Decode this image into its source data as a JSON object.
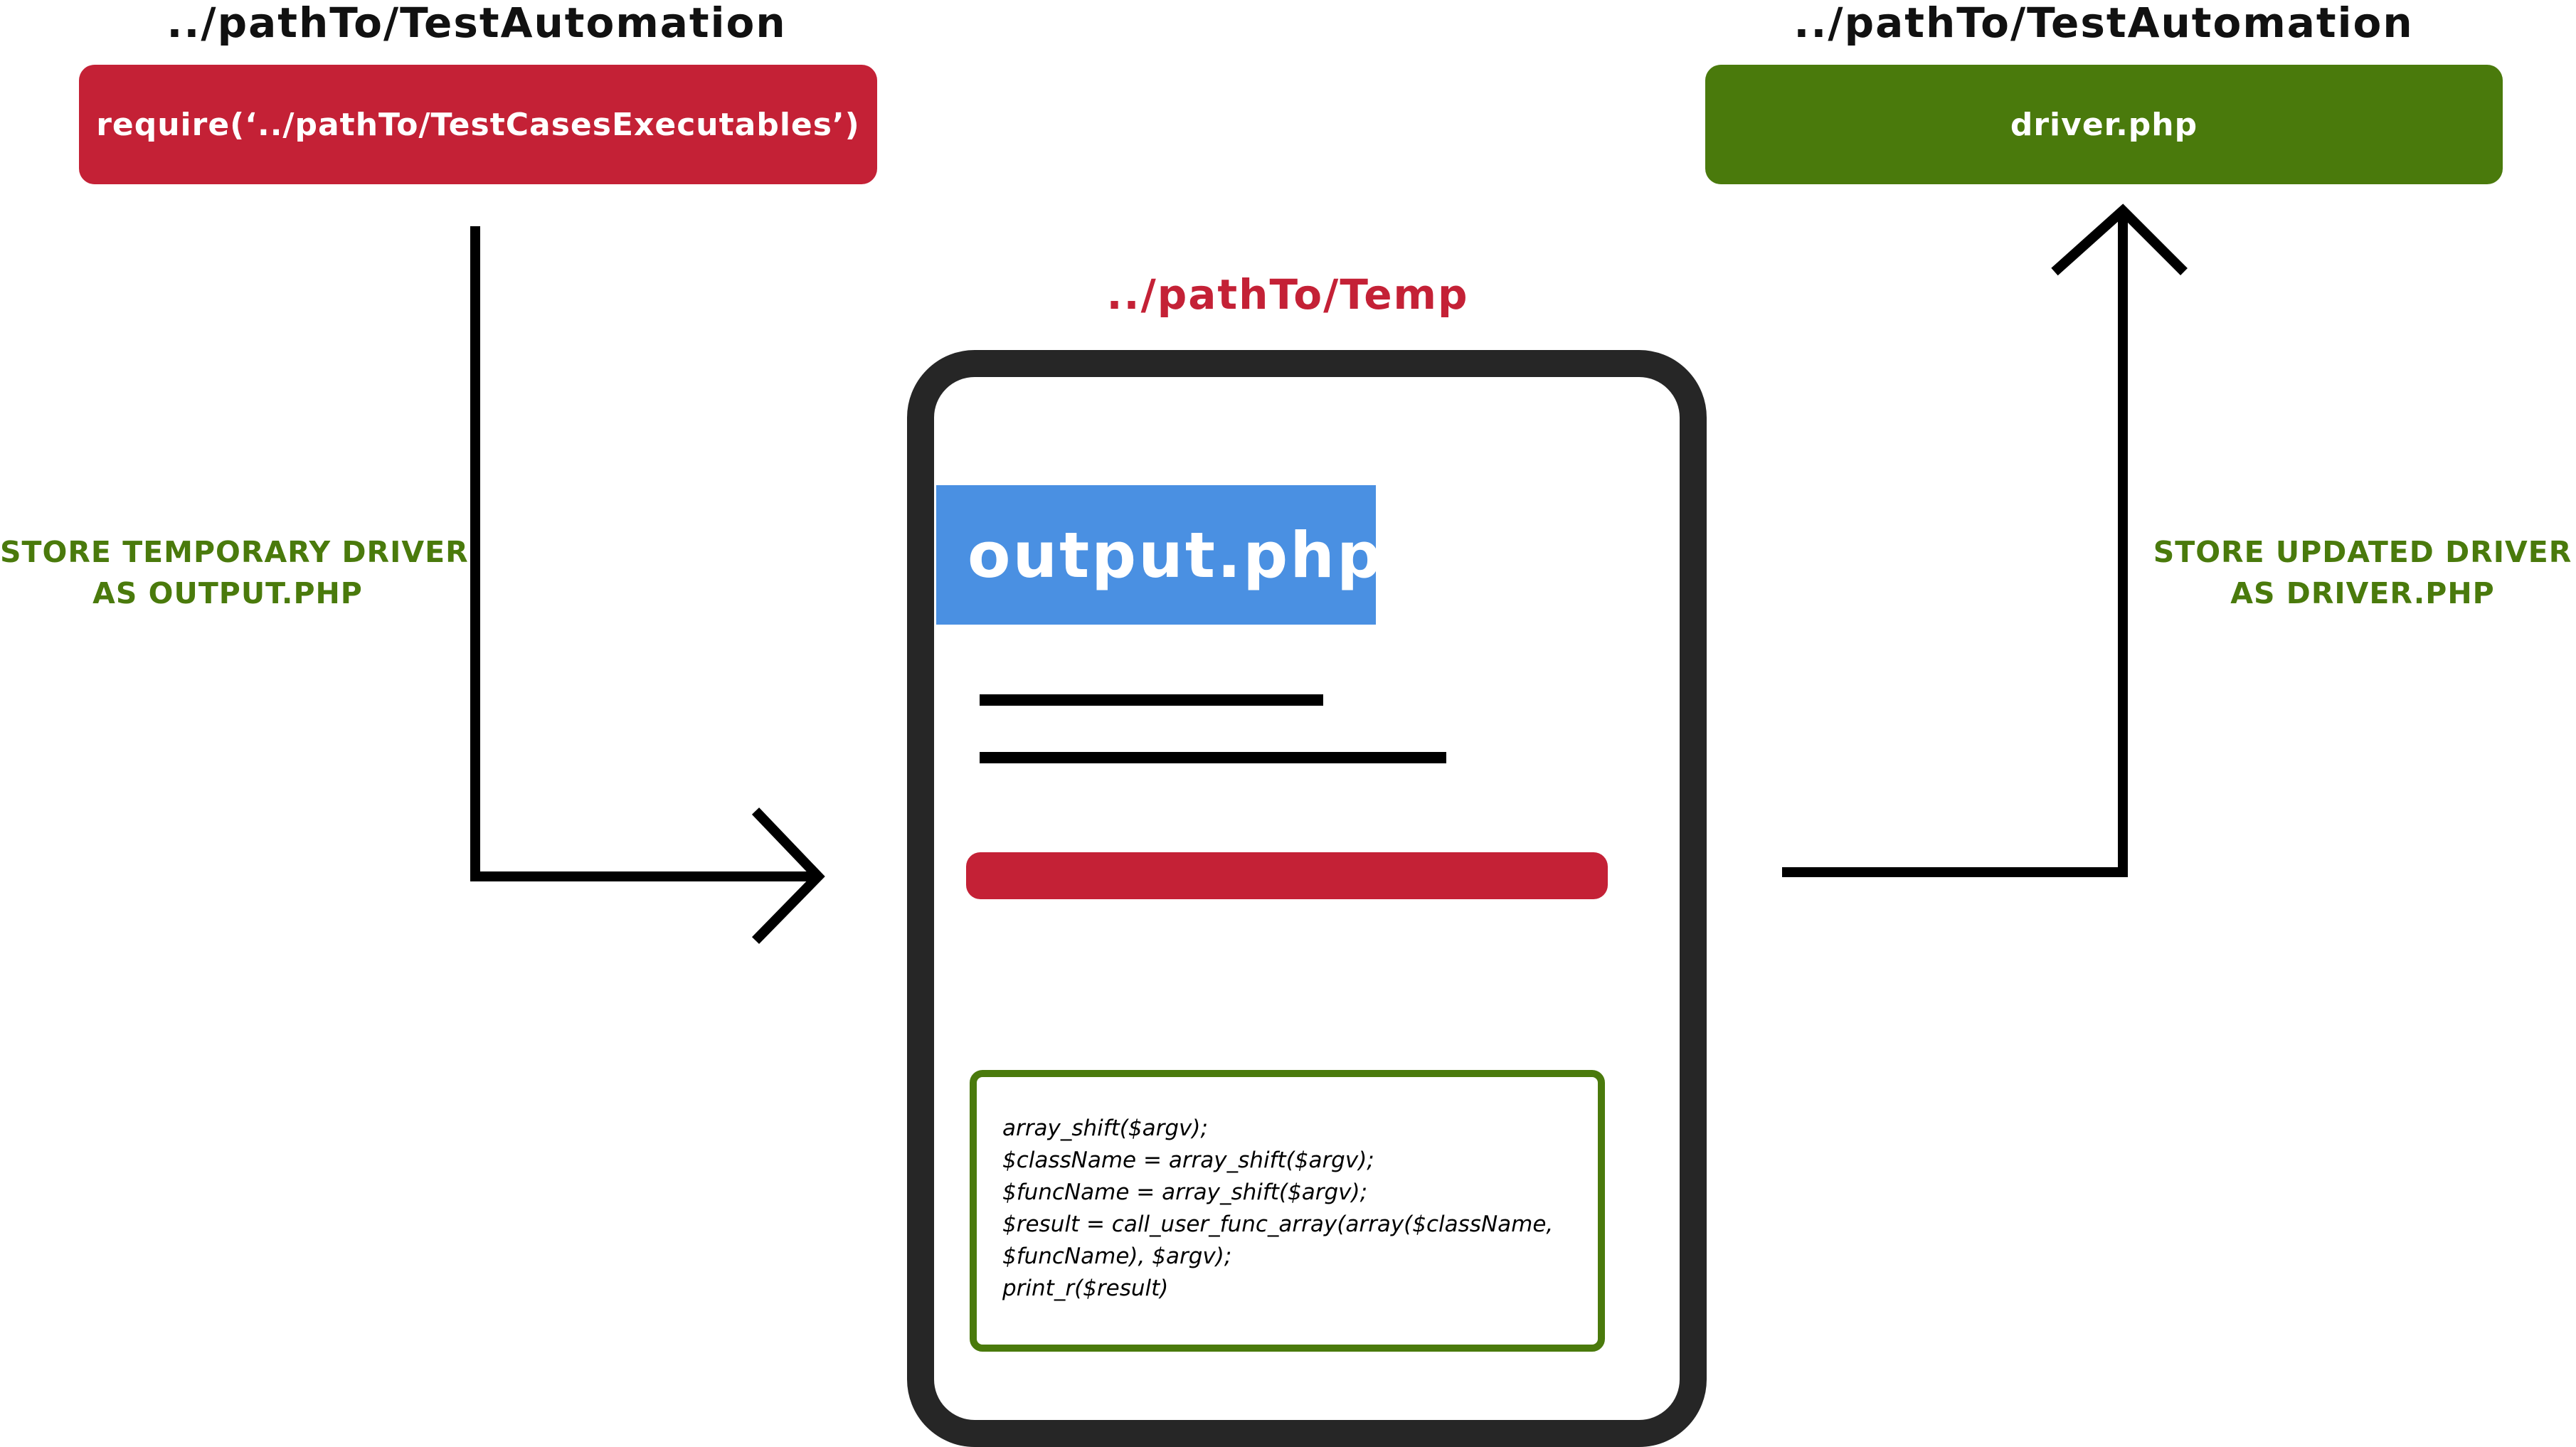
{
  "left": {
    "path_label": "../pathTo/TestAutomation",
    "box_label": "require(‘../pathTo/TestCasesExecutables’)",
    "box_color": "#c42136",
    "side_label_line1": "STORE TEMPORARY DRIVER",
    "side_label_line2": "AS OUTPUT.PHP"
  },
  "right": {
    "path_label": "../pathTo/TestAutomation",
    "box_label": "driver.php",
    "box_color": "#4a7a0c",
    "side_label_line1": "STORE UPDATED DRIVER",
    "side_label_line2": "AS DRIVER.PHP"
  },
  "center": {
    "path_label": "../pathTo/Temp",
    "file_title": "output.php",
    "code_lines": [
      "array_shift($argv);",
      "$className = array_shift($argv);",
      "$funcName = array_shift($argv);",
      "$result = call_user_func_array(array($className,",
      "$funcName), $argv);",
      "print_r($result)"
    ]
  },
  "colors": {
    "red": "#c42136",
    "green": "#4a7a0c",
    "blue": "#4a90e2",
    "device_frame": "#262626"
  }
}
